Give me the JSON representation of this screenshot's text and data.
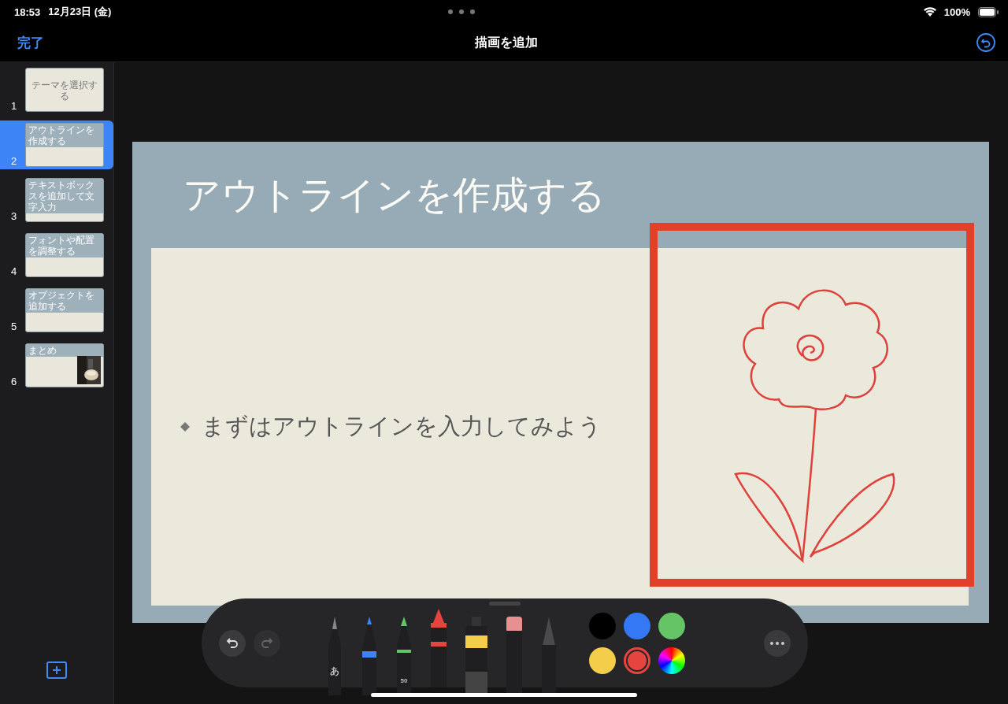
{
  "status_bar": {
    "time": "18:53",
    "date": "12月23日 (金)",
    "battery": "100%"
  },
  "nav_bar": {
    "done": "完了",
    "title": "描画を追加"
  },
  "slides": [
    {
      "number": "1",
      "title": "テーマを選択する",
      "kind": "title",
      "selected": false
    },
    {
      "number": "2",
      "title": "アウトラインを作成する",
      "kind": "header",
      "selected": true
    },
    {
      "number": "3",
      "title": "テキストボックスを追加して文字入力",
      "kind": "header",
      "selected": false
    },
    {
      "number": "4",
      "title": "フォントや配置を調整する",
      "kind": "header",
      "selected": false
    },
    {
      "number": "5",
      "title": "オブジェクトを追加する",
      "kind": "header",
      "selected": false
    },
    {
      "number": "6",
      "title": "まとめ",
      "kind": "picture",
      "selected": false
    }
  ],
  "slide": {
    "title": "アウトラインを作成する",
    "bullet": "まずはアウトラインを入力してみよう"
  },
  "tools": [
    {
      "kind": "pencil",
      "label": "あ",
      "selected": false
    },
    {
      "kind": "pen",
      "selected": false
    },
    {
      "kind": "marker",
      "label": "50",
      "selected": false
    },
    {
      "kind": "crayon",
      "selected": true
    },
    {
      "kind": "paint",
      "selected": false
    },
    {
      "kind": "eraser",
      "selected": false
    },
    {
      "kind": "fill",
      "selected": false
    }
  ],
  "colors": [
    {
      "kind": "swatch",
      "color": "#000000",
      "selected": false
    },
    {
      "kind": "swatch",
      "color": "#3478f6",
      "selected": false
    },
    {
      "kind": "swatch",
      "color": "#65c466",
      "selected": false
    },
    {
      "kind": "swatch",
      "color": "#f4cd4b",
      "selected": false
    },
    {
      "kind": "swatch",
      "color": "#e5443f",
      "selected": true
    },
    {
      "kind": "wheel",
      "selected": false
    }
  ]
}
